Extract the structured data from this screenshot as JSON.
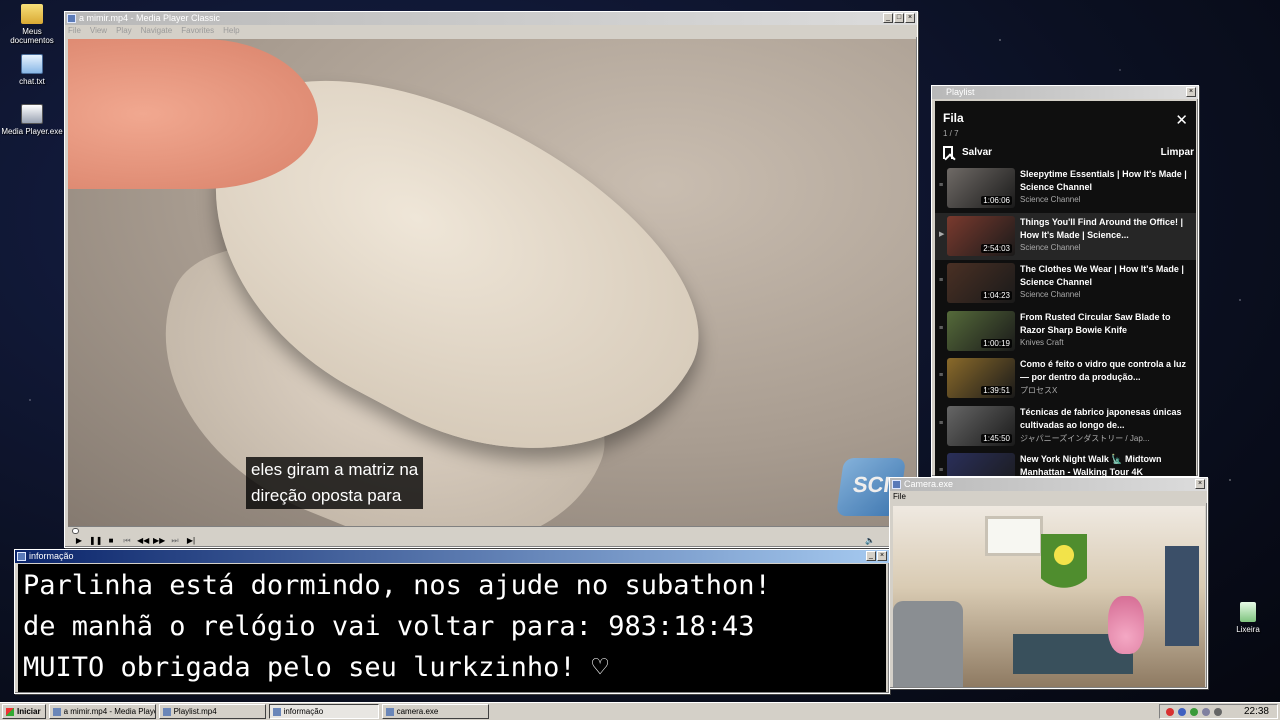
{
  "desktop": {
    "icons": [
      {
        "label": "Meus documentos",
        "icon": "folder-icon"
      },
      {
        "label": "chat.txt",
        "icon": "text-file-icon"
      },
      {
        "label": "Media Player.exe",
        "icon": "media-player-icon"
      },
      {
        "label": "Lixeira",
        "icon": "recycle-bin-icon"
      }
    ]
  },
  "media_player": {
    "title": "a mimir.mp4 - Media Player Classic",
    "menu": [
      "File",
      "View",
      "Play",
      "Navigate",
      "Favorites",
      "Help"
    ],
    "caption_line1": "eles giram a matriz na",
    "caption_line2": "direção oposta para",
    "watermark": "SCI",
    "progress": 0.005
  },
  "playlist": {
    "window_title": "Playlist",
    "title": "Fila",
    "count": "1 / 7",
    "save_label": "Salvar",
    "clear_label": "Limpar",
    "items": [
      {
        "title": "Sleepytime Essentials | How It's Made | Science Channel",
        "channel": "Science Channel",
        "duration": "1:06:06",
        "thumb": "#6f6a66"
      },
      {
        "title": "Things You'll Find Around the Office! | How It's Made | Science...",
        "channel": "Science Channel",
        "duration": "2:54:03",
        "thumb": "#7a3a2e",
        "current": true
      },
      {
        "title": "The Clothes We Wear | How It's Made | Science Channel",
        "channel": "Science Channel",
        "duration": "1:04:23",
        "thumb": "#4a3024"
      },
      {
        "title": "From Rusted Circular Saw Blade to Razor Sharp Bowie Knife",
        "channel": "Knives Craft",
        "duration": "1:00:19",
        "thumb": "#556a3a"
      },
      {
        "title": "Como é feito o vidro que controla a luz — por dentro da produção...",
        "channel": "プロセスX",
        "duration": "1:39:51",
        "thumb": "#8a6a2a"
      },
      {
        "title": "Técnicas de fabrico japonesas únicas cultivadas ao longo de...",
        "channel": "ジャパニーズインダストリー / Jap...",
        "duration": "1:45:50",
        "thumb": "#666666"
      },
      {
        "title": "New York Night Walk 🗽 Midtown Manhattan - Walking Tour 4K",
        "channel": "",
        "duration": "",
        "thumb": "#2a2f5a"
      }
    ]
  },
  "info": {
    "title": "informação",
    "line1": "Parlinha está dormindo, nos ajude no subathon!",
    "line2": "de manhã o relógio vai voltar para:  983:18:43",
    "line3": "MUITO obrigada pelo seu lurkzinho! ♡"
  },
  "camera": {
    "title": "Camera.exe",
    "menu_file": "File"
  },
  "taskbar": {
    "start": "Iniciar",
    "tasks": [
      {
        "label": "a mimir.mp4 - Media Playe..."
      },
      {
        "label": "Playlist.mp4"
      },
      {
        "label": "informação",
        "active": true
      },
      {
        "label": "camera.exe"
      }
    ],
    "clock": "22:38",
    "tray_colors": [
      "#d83030",
      "#4060c0",
      "#3a9a3a",
      "#8080a0",
      "#666"
    ]
  }
}
